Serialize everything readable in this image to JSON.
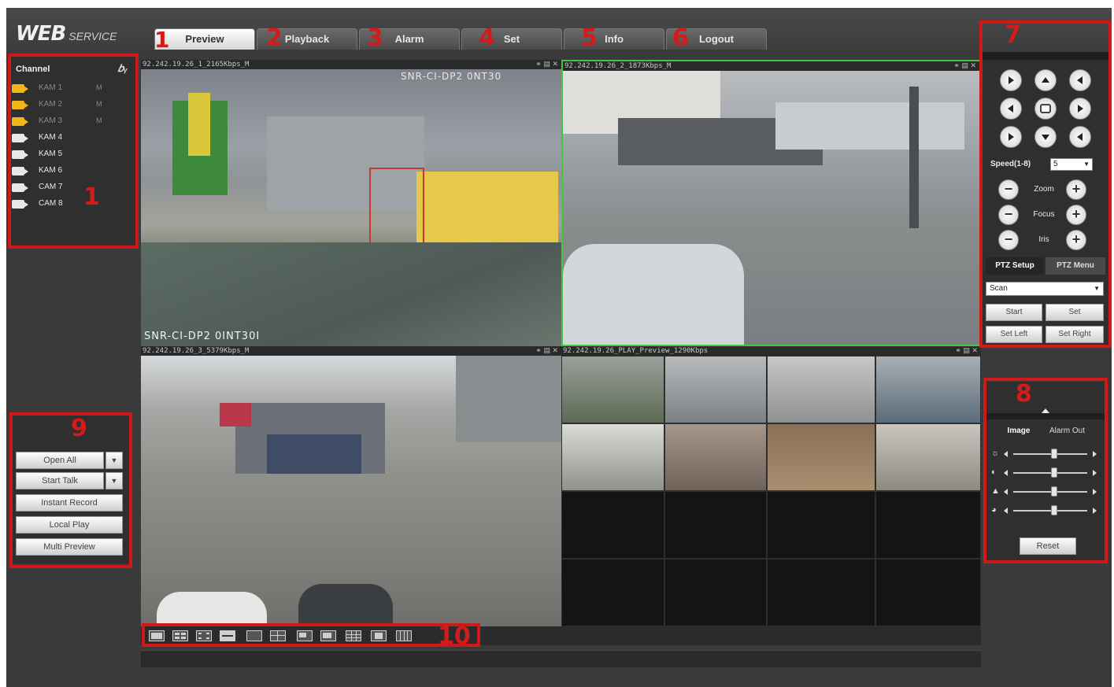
{
  "brand": {
    "main": "WEB",
    "sub": "SERVICE"
  },
  "tabs": [
    {
      "num": "1",
      "label": "Preview"
    },
    {
      "num": "2",
      "label": "Playback"
    },
    {
      "num": "3",
      "label": "Alarm"
    },
    {
      "num": "4",
      "label": "Set"
    },
    {
      "num": "5",
      "label": "Info"
    },
    {
      "num": "6",
      "label": "Logout"
    }
  ],
  "channels": {
    "header": "Channel",
    "header_icon": "talk-icon",
    "items": [
      {
        "label": "KAM 1",
        "stream": "M",
        "open": true
      },
      {
        "label": "KAM 2",
        "stream": "M",
        "open": true
      },
      {
        "label": "KAM 3",
        "stream": "M",
        "open": true
      },
      {
        "label": "KAM 4",
        "stream": "",
        "open": false
      },
      {
        "label": "KAM 5",
        "stream": "",
        "open": false
      },
      {
        "label": "KAM 6",
        "stream": "",
        "open": false
      },
      {
        "label": "CAM 7",
        "stream": "",
        "open": false
      },
      {
        "label": "CAM 8",
        "stream": "",
        "open": false
      }
    ]
  },
  "controls": {
    "open_all": "Open All",
    "start_talk": "Start Talk",
    "instant_record": "Instant Record",
    "local_play": "Local Play",
    "multi_preview": "Multi Preview"
  },
  "videos": [
    {
      "title": "92.242.19.26_1_2165Kbps_M",
      "osd_top": "SNR-CI-DP2 0NT30",
      "osd_bottom": "SNR-CI-DP2 0INT30I"
    },
    {
      "title": "92.242.19.26_2_1873Kbps_M"
    },
    {
      "title": "92.242.19.26_3_5379Kbps_M"
    },
    {
      "title": "92.242.19.26_PLAY_Preview_1290Kbps"
    }
  ],
  "ptz": {
    "speed_label": "Speed(1-8)",
    "speed_value": "5",
    "zoom": "Zoom",
    "focus": "Focus",
    "iris": "Iris",
    "tab_setup": "PTZ Setup",
    "tab_menu": "PTZ Menu",
    "scan_value": "Scan",
    "start": "Start",
    "set": "Set",
    "set_left": "Set Left",
    "set_right": "Set Right"
  },
  "image_panel": {
    "tab_image": "Image",
    "tab_alarm": "Alarm Out",
    "sliders": [
      {
        "icon": "brightness-icon",
        "glyph": "☼",
        "level": 0.55
      },
      {
        "icon": "contrast-icon",
        "glyph": "◐",
        "level": 0.55
      },
      {
        "icon": "saturation-icon",
        "glyph": "▲",
        "level": 0.55
      },
      {
        "icon": "hue-icon",
        "glyph": "◕",
        "level": 0.55
      }
    ],
    "reset": "Reset"
  },
  "annotations": [
    "1",
    "2",
    "3",
    "4",
    "5",
    "6",
    "7",
    "8",
    "9",
    "10"
  ],
  "colors": {
    "annotation": "#d01818",
    "selected_frame": "#3ec93e",
    "accent_yellow": "#f2b418"
  }
}
